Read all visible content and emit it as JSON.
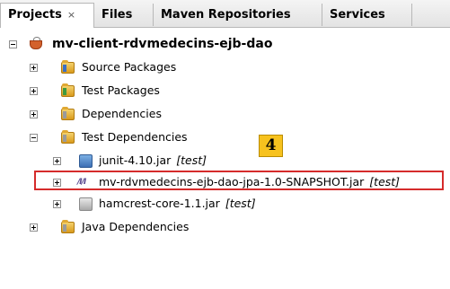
{
  "tabs": [
    {
      "label": "Projects",
      "close": "×"
    },
    {
      "label": "Files"
    },
    {
      "label": "Maven Repositories"
    },
    {
      "label": "Services"
    }
  ],
  "tree": {
    "project": {
      "label": "mv-client-rdvmedecins-ejb-dao",
      "icon": "coffee-cup-icon"
    },
    "nodes": [
      {
        "label": "Source Packages",
        "icon": "folder-icon"
      },
      {
        "label": "Test Packages",
        "icon": "folder-icon"
      },
      {
        "label": "Dependencies",
        "icon": "folder-icon"
      },
      {
        "label": "Test Dependencies",
        "icon": "folder-icon"
      },
      {
        "label": "junit-4.10.jar",
        "tag": "[test]",
        "icon": "jar-icon"
      },
      {
        "label": "mv-rdvmedecins-ejb-dao-jpa-1.0-SNAPSHOT.jar",
        "tag": "[test]",
        "icon": "maven-icon"
      },
      {
        "label": "hamcrest-core-1.1.jar",
        "tag": "[test]",
        "icon": "jar-icon"
      },
      {
        "label": "Java Dependencies",
        "icon": "folder-icon"
      }
    ]
  },
  "callout": {
    "number": "4"
  },
  "colors": {
    "highlight_border": "#d52b2b",
    "badge_fill": "#f7c21e"
  }
}
